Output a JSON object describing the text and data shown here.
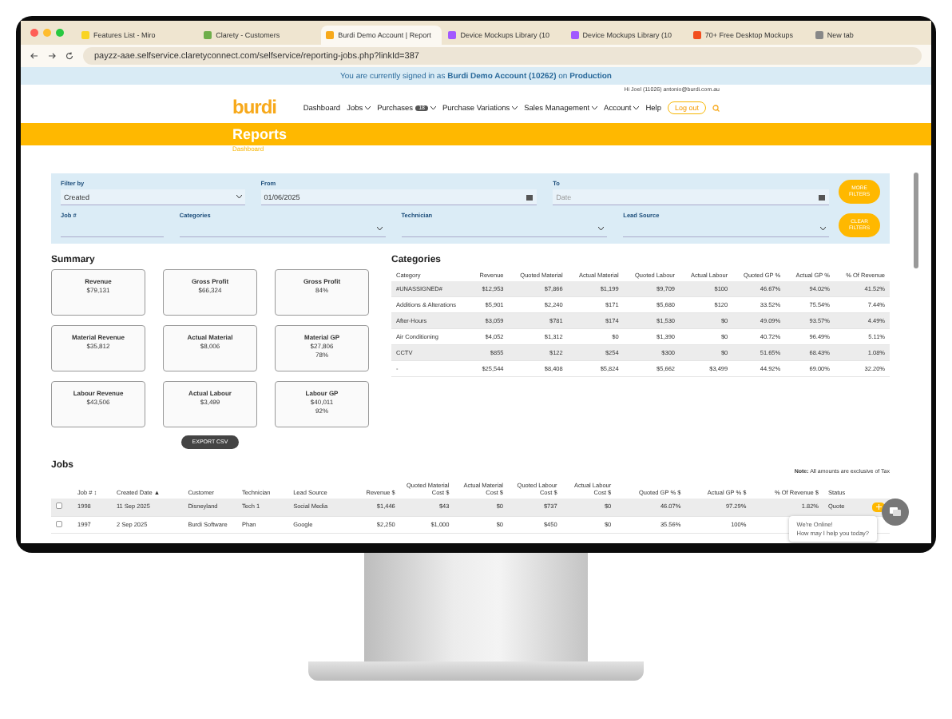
{
  "browser": {
    "tabs": [
      {
        "label": "Features List - Miro",
        "selected": false
      },
      {
        "label": "Clarety - Customers",
        "selected": false
      },
      {
        "label": "Burdi Demo Account | Report",
        "selected": true
      },
      {
        "label": "Device Mockups Library (10",
        "selected": false
      },
      {
        "label": "Device Mockups Library (10",
        "selected": false
      },
      {
        "label": "70+ Free Desktop Mockups",
        "selected": false
      },
      {
        "label": "New tab",
        "selected": false
      }
    ],
    "url": "payzz-aae.selfservice.claretyconnect.com/selfservice/reporting-jobs.php?linkId=387"
  },
  "banner": "You are currently signed in as **Burdi Demo Account (10262)** on **Production**",
  "header": {
    "user": "Hi Joel (11026) antonio@burdi.com.au",
    "logo": "burdi",
    "nav": [
      {
        "label": "Dashboard",
        "dropdown": false
      },
      {
        "label": "Jobs",
        "dropdown": true
      },
      {
        "label": "Purchases",
        "dropdown": true,
        "badge": "18"
      },
      {
        "label": "Purchase Variations",
        "dropdown": true
      },
      {
        "label": "Sales Management",
        "dropdown": true
      },
      {
        "label": "Account",
        "dropdown": true
      },
      {
        "label": "Help",
        "dropdown": false
      }
    ],
    "logout": "Log out"
  },
  "page": {
    "title": "Reports",
    "breadcrumb": "Dashboard"
  },
  "filters": {
    "rows": [
      [
        {
          "label": "Filter by",
          "kind": "select",
          "value": "Created"
        },
        {
          "label": "From",
          "kind": "date",
          "value": "01/06/2025"
        },
        {
          "label": "To",
          "kind": "date",
          "placeholder": "Date"
        }
      ],
      [
        {
          "label": "Job #",
          "kind": "text"
        },
        {
          "label": "Categories",
          "kind": "select"
        },
        {
          "label": "Technician",
          "kind": "select"
        },
        {
          "label": "Lead Source",
          "kind": "select"
        }
      ]
    ],
    "buttons": [
      "MORE FILTERS",
      "CLEAR FILTERS"
    ]
  },
  "summary": {
    "title": "Summary",
    "cards": [
      {
        "label": "Revenue",
        "values": [
          "$79,131"
        ]
      },
      {
        "label": "Gross Profit",
        "values": [
          "$66,324"
        ]
      },
      {
        "label": "Gross Profit",
        "values": [
          "84%"
        ]
      },
      {
        "label": "Material Revenue",
        "values": [
          "$35,812"
        ]
      },
      {
        "label": "Actual Material",
        "values": [
          "$8,006"
        ]
      },
      {
        "label": "Material GP",
        "values": [
          "$27,806",
          "78%"
        ]
      },
      {
        "label": "Labour Revenue",
        "values": [
          "$43,506"
        ]
      },
      {
        "label": "Actual Labour",
        "values": [
          "$3,499"
        ]
      },
      {
        "label": "Labour GP",
        "values": [
          "$40,011",
          "92%"
        ]
      }
    ],
    "export": "EXPORT CSV"
  },
  "categories": {
    "title": "Categories",
    "columns": [
      "Category",
      "Revenue",
      "Quoted Material",
      "Actual Material",
      "Quoted Labour",
      "Actual Labour",
      "Quoted GP %",
      "Actual GP %",
      "% Of Revenue"
    ],
    "rows": [
      [
        "#UNASSIGNED#",
        "$12,953",
        "$7,866",
        "$1,199",
        "$9,709",
        "$100",
        "46.67%",
        "94.02%",
        "41.52%"
      ],
      [
        "Additions & Alterations",
        "$5,901",
        "$2,240",
        "$171",
        "$5,680",
        "$120",
        "33.52%",
        "75.54%",
        "7.44%"
      ],
      [
        "After-Hours",
        "$3,059",
        "$781",
        "$174",
        "$1,530",
        "$0",
        "49.09%",
        "93.57%",
        "4.49%"
      ],
      [
        "Air Conditioning",
        "$4,052",
        "$1,312",
        "$0",
        "$1,390",
        "$0",
        "40.72%",
        "96.49%",
        "5.11%"
      ],
      [
        "CCTV",
        "$855",
        "$122",
        "$254",
        "$300",
        "$0",
        "51.65%",
        "68.43%",
        "1.08%"
      ],
      [
        "-",
        "$25,544",
        "$8,408",
        "$5,824",
        "$5,662",
        "$3,499",
        "44.92%",
        "69.00%",
        "32.20%"
      ]
    ]
  },
  "jobs": {
    "title": "Jobs",
    "note": "**Note:** All amounts are exclusive of Tax",
    "columns": [
      "Job # ↕",
      "Created Date ▲",
      "Customer",
      "Technician",
      "Lead Source",
      "Revenue $",
      "Quoted Material Cost $",
      "Actual Material Cost $",
      "Quoted Labour Cost $",
      "Actual Labour Cost $",
      "Quoted GP % $",
      "Actual GP % $",
      "% Of Revenue $",
      "Status"
    ],
    "rows": [
      {
        "checked": false,
        "cells": [
          "1998",
          "11 Sep 2025",
          "Disneyland",
          "Tech 1",
          "Social Media",
          "$1,446",
          "$43",
          "$0",
          "$737",
          "$0",
          "46.07%",
          "97.29%",
          "1.82%",
          "Quote"
        ]
      },
      {
        "checked": false,
        "cells": [
          "1997",
          "2 Sep 2025",
          "Burdi Software",
          "Phan",
          "Google",
          "$2,250",
          "$1,000",
          "$0",
          "$450",
          "$0",
          "35.56%",
          "100%",
          "",
          ""
        ]
      }
    ]
  },
  "chat": {
    "title": "We're Online!",
    "subtitle": "How may I help you today?"
  }
}
